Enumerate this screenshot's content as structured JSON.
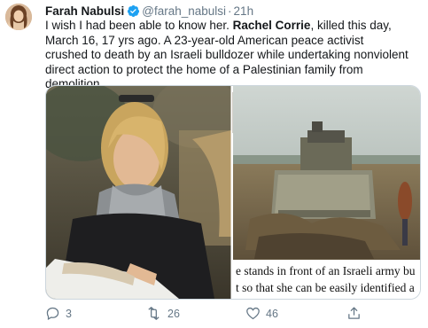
{
  "tweet": {
    "author_name": "Farah Nabulsi",
    "author_handle": "@farah_nabulsi",
    "separator": "·",
    "time": "21h",
    "text_before": "I wish I had been able to know her. ",
    "text_bold": "Rachel Corrie",
    "text_after": ", killed this day, March 16, 17 yrs ago. A 23-year-old American peace activist crushed to death by an Israeli bulldozer while undertaking nonviolent direct action to protect the home of a Palestinian family from demolition."
  },
  "media": {
    "caption_line1": "e stands in front of an Israeli army bu",
    "caption_line2": "t so that she can be easily identified a"
  },
  "actions": {
    "reply_count": "3",
    "retweet_count": "26",
    "like_count": "46"
  },
  "colors": {
    "verified": "#1da1f2",
    "secondary_text": "#657786"
  },
  "icons": [
    "avatar",
    "verified-badge-icon",
    "reply-icon",
    "retweet-icon",
    "like-icon",
    "share-icon"
  ]
}
